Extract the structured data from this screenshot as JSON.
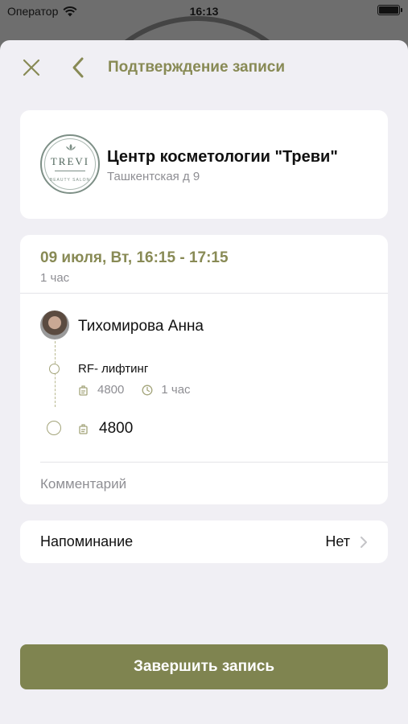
{
  "status_bar": {
    "carrier": "Оператор",
    "time": "16:13"
  },
  "nav": {
    "title": "Подтверждение записи",
    "close_icon": "close-icon",
    "back_icon": "chevron-left-icon"
  },
  "salon": {
    "logo_word": "TREVI",
    "logo_sub": "BEAUTY SALON",
    "name": "Центр косметологии \"Треви\"",
    "address": "Ташкентская д 9"
  },
  "appointment": {
    "date_time": "09 июля, Вт, 16:15 - 17:15",
    "duration": "1 час",
    "master": "Тихомирова Анна",
    "service": {
      "name": "RF- лифтинг",
      "price": "4800",
      "duration": "1 час"
    },
    "total": "4800",
    "comment_placeholder": "Комментарий"
  },
  "reminder": {
    "label": "Напоминание",
    "value": "Нет"
  },
  "finish_button": "Завершить запись",
  "colors": {
    "accent": "#888a55",
    "button": "#7f8450",
    "background": "#f0eff4"
  }
}
